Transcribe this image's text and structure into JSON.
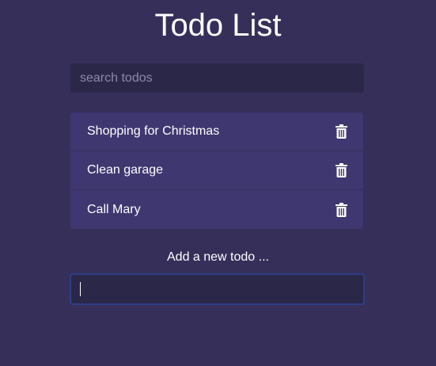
{
  "header": {
    "title": "Todo List"
  },
  "search": {
    "placeholder": "search todos",
    "value": ""
  },
  "todos": [
    {
      "text": "Shopping for Christmas",
      "action_icon": "trash-icon"
    },
    {
      "text": "Clean garage",
      "action_icon": "trash-icon"
    },
    {
      "text": "Call Mary",
      "action_icon": "trash-icon"
    }
  ],
  "add_form": {
    "label": "Add a new todo ...",
    "value": ""
  },
  "colors": {
    "background": "#352f59",
    "input_background": "#2b2749",
    "item_background": "#3f3770",
    "focus_border": "#2d3f88",
    "text": "#ffffff"
  }
}
